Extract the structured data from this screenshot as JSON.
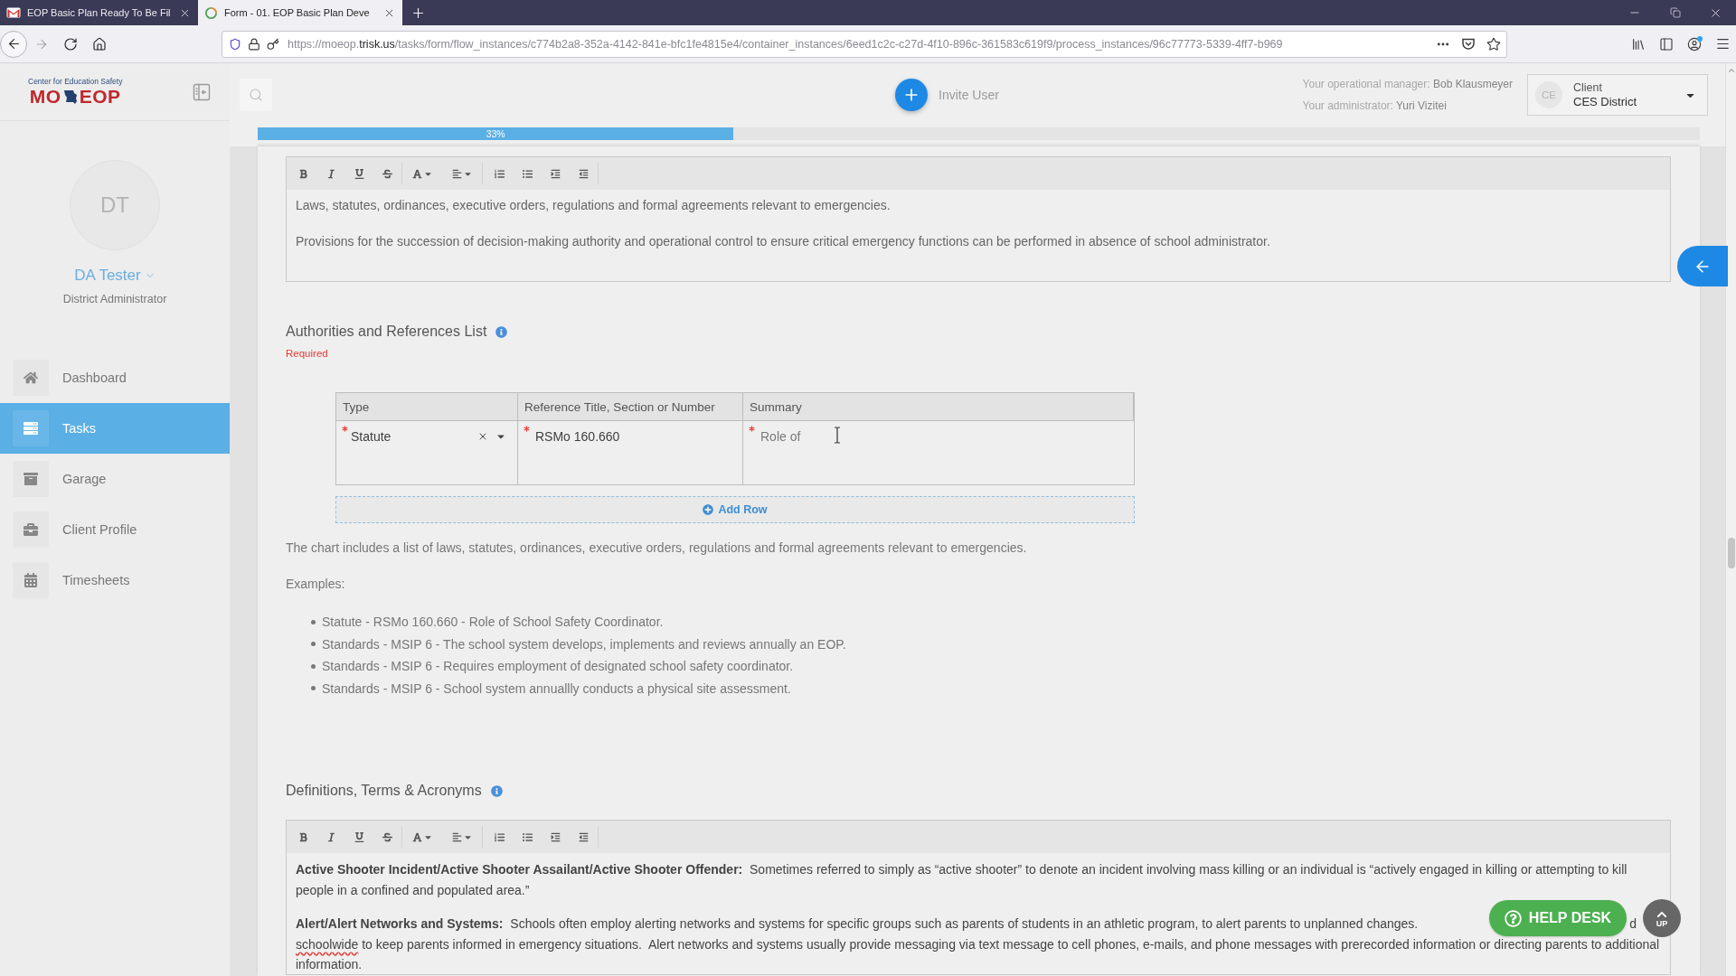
{
  "browser": {
    "tabs": [
      {
        "kind": "mail",
        "title": "EOP Basic Plan Ready To Be Fil",
        "selected": false
      },
      {
        "kind": "loading",
        "title": "Form - 01. EOP Basic Plan Deve",
        "selected": true
      }
    ],
    "url": {
      "prefix": "https://moeop.",
      "domain": "trisk.us",
      "path": "/tasks/form/flow_instances/c774b2a8-352a-4142-841e-bfc1fe4815e4/container_instances/6eed1c2c-c27d-4f10-896c-361583c619f9/process_instances/96c77773-5339-4ff7-b969"
    }
  },
  "sidebar": {
    "logo": {
      "tagline": "Center for Education Safety",
      "left": "MO",
      "right": "EOP"
    },
    "user": {
      "initials": "DT",
      "name": "DA Tester",
      "role": "District Administrator"
    },
    "items": [
      {
        "label": "Dashboard",
        "selected": false
      },
      {
        "label": "Tasks",
        "selected": true
      },
      {
        "label": "Garage",
        "selected": false
      },
      {
        "label": "Client Profile",
        "selected": false
      },
      {
        "label": "Timesheets",
        "selected": false
      }
    ]
  },
  "header": {
    "invite": "Invite User",
    "manager": {
      "label": "Your operational manager:",
      "name": "Bob Klausmeyer"
    },
    "administrator": {
      "label": "Your administrator:",
      "name": "Yuri Vizitei"
    },
    "client": {
      "initials": "CE",
      "label": "Client",
      "value": "CES District"
    }
  },
  "progress": {
    "level": 0.33,
    "label": "33%"
  },
  "plan_editor": {
    "paragraphs": [
      "Laws, statutes, ordinances, executive orders, regulations and formal agreements relevant to emergencies.",
      "Provisions for the succession of decision-making authority and operational control to ensure critical emergency functions can be performed in absence of school administrator."
    ]
  },
  "authorities": {
    "title": "Authorities and References List",
    "required_note": "Required",
    "table": {
      "columns": [
        "Type",
        "Reference Title, Section or Number",
        "Summary"
      ],
      "rows": [
        {
          "type": {
            "value": "Statute",
            "required": true
          },
          "reference": {
            "value": "RSMo 160.660",
            "required": true
          },
          "summary": {
            "value": "Role of",
            "required": true
          }
        }
      ]
    },
    "add_row": "Add Row",
    "description": "The chart includes a list of laws, statutes, ordinances, executive orders, regulations and formal agreements relevant to emergencies.",
    "examples_label": "Examples:",
    "examples": [
      "Statute - RSMo 160.660 - Role of School Safety Coordinator.",
      "Standards - MSIP 6 - The school system develops, implements and reviews annually an EOP.",
      "Standards - MSIP 6 - Requires employment of designated school safety coordinator.",
      "Standards - MSIP 6 - School system annuallly conducts a physical site assessment."
    ]
  },
  "definitions": {
    "title": "Definitions, Terms & Acronyms",
    "entries": [
      {
        "text": "**Active Shooter Incident/Active Shooter Assailant/Active Shooter Offender:**  Sometimes referred to simply as “active shooter” to denote an incident involving mass killing or an individual is “actively engaged in killing or attempting to kill people in a confined and populated area.”"
      },
      {
        "text": "**Alert/Alert Networks and Systems:**  Schools often employ alerting networks and systems for specific groups such as parents of students in an athletic program, to alert parents to unplanned changes.",
        "covered_tail": "d",
        "continuation": {
          "misspelled": "schoolwide",
          "text": " to keep parents informed in emergency situations.  Alert networks and systems usually provide messaging via text message to cell phones, e-mails, and phone messages with prerecorded information or directing parents to additional information."
        }
      }
    ]
  },
  "help_desk": "HELP DESK",
  "up_button": "UP"
}
